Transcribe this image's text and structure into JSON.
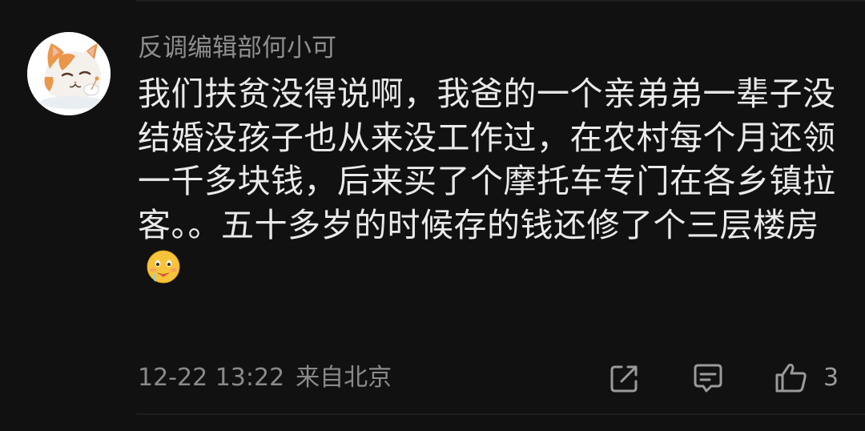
{
  "comment": {
    "username": "反调编辑部何小可",
    "text": "我们扶贫没得说啊，我爸的一个亲弟弟一辈子没结婚没孩子也从来没工作过，在农村每个月还领一千多块钱，后来买了个摩托车专门在各乡镇拉客。。五十多岁的时候存的钱还修了个三层楼房",
    "emoji": "drooling-face-emoji",
    "timestamp": "12-22 13:22",
    "location": "来自北京",
    "likes": "3"
  },
  "icons": {
    "share": "share-icon",
    "reply": "reply-comment-icon",
    "like": "thumbs-up-icon"
  },
  "colors": {
    "background": "#111111",
    "username": "#8e8e8e",
    "body_text": "#eaeaea",
    "meta_text": "#8a8a8a",
    "icon": "#9a9a9a"
  }
}
